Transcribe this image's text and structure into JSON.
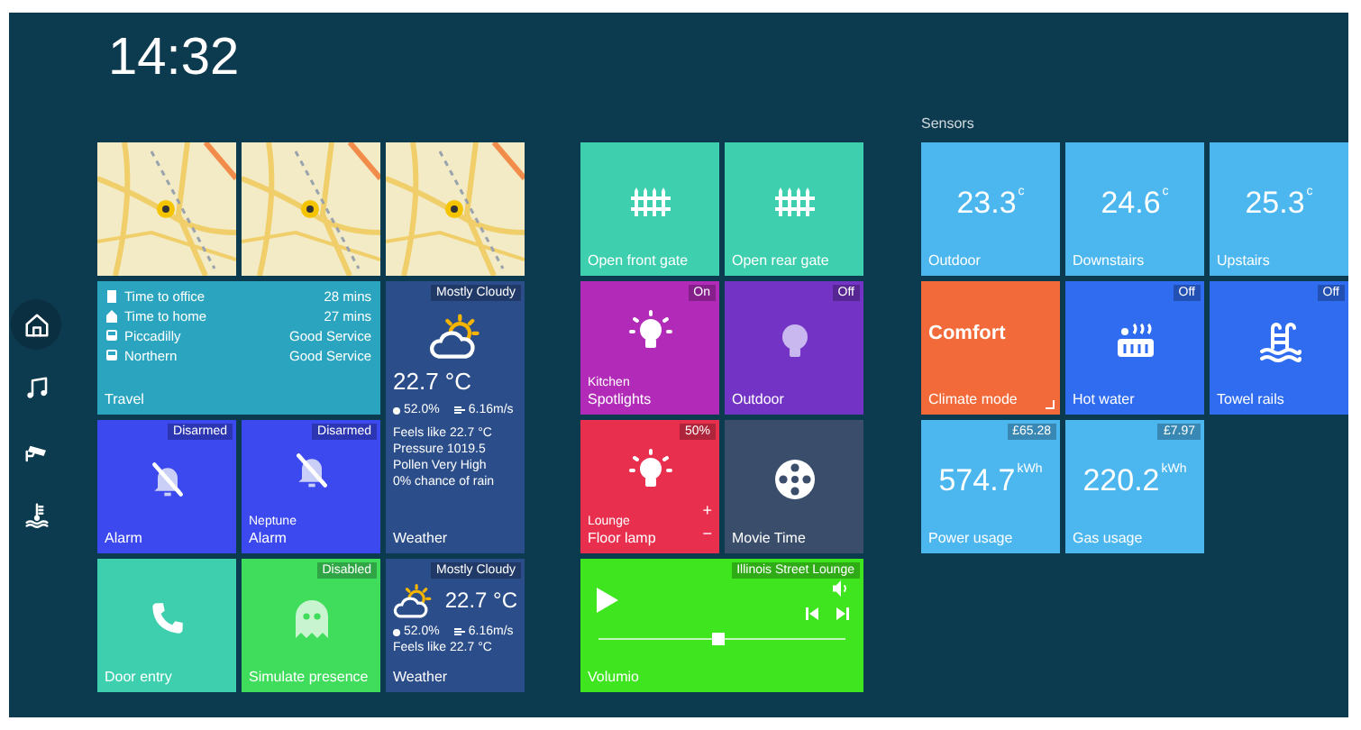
{
  "clock": "14:32",
  "sidebar": {
    "items": [
      {
        "kind": "home",
        "selected": true
      },
      {
        "kind": "music",
        "selected": false
      },
      {
        "kind": "camera",
        "selected": false
      },
      {
        "kind": "water-temp",
        "selected": false
      }
    ]
  },
  "groups": [
    {
      "tiles": [
        {
          "kind": "map",
          "color": "#f3ebc6"
        },
        {
          "kind": "map",
          "color": "#f3ebc6"
        },
        {
          "kind": "map",
          "color": "#f3ebc6"
        },
        {
          "kind": "travel",
          "color": "#2ba5bf",
          "label": "Travel",
          "rows": [
            {
              "name": "Time to office",
              "value": "28 mins"
            },
            {
              "name": "Time to home",
              "value": "27 mins"
            },
            {
              "name": "Piccadilly",
              "value": "Good Service"
            },
            {
              "name": "Northern",
              "value": "Good Service"
            }
          ]
        },
        {
          "kind": "alarm",
          "color": "#3c49ee",
          "badge": "Disarmed",
          "label": "Alarm"
        },
        {
          "kind": "alarm",
          "color": "#3c49ee",
          "badge": "Disarmed",
          "sublabel": "Neptune",
          "label": "Alarm"
        },
        {
          "kind": "weather",
          "color": "#2b4d8a",
          "badge": "Mostly Cloudy",
          "temp": "22.7 °C",
          "humidity": "52.0%",
          "wind": "6.16m/s",
          "details": [
            "Feels like 22.7 °C",
            "Pressure 1019.5",
            "Pollen Very High",
            "0% chance of rain"
          ],
          "label": "Weather"
        },
        {
          "kind": "phone",
          "color": "#3ecfae",
          "label": "Door entry"
        },
        {
          "kind": "ghost",
          "color": "#40dc5c",
          "badge": "Disabled",
          "label": "Simulate presence"
        },
        {
          "kind": "weather-small",
          "color": "#2b4d8a",
          "badge": "Mostly Cloudy",
          "temp": "22.7 °C",
          "humidity": "52.0%",
          "wind": "6.16m/s",
          "details": [
            "Feels like 22.7 °C"
          ],
          "label": "Weather"
        }
      ]
    },
    {
      "tiles": [
        {
          "kind": "gate",
          "color": "#3ecfae",
          "label": "Open front gate"
        },
        {
          "kind": "gate",
          "color": "#3ecfae",
          "label": "Open rear gate"
        },
        {
          "kind": "light",
          "color": "#b22bb8",
          "badge": "On",
          "on": true,
          "sublabel": "Kitchen",
          "label": "Spotlights"
        },
        {
          "kind": "light",
          "color": "#7333c4",
          "badge": "Off",
          "on": false,
          "label": "Outdoor"
        },
        {
          "kind": "light",
          "color": "#e8304e",
          "badge": "50%",
          "on": true,
          "sublabel": "Lounge",
          "label": "Floor lamp",
          "plus": "+",
          "minus": "−"
        },
        {
          "kind": "film",
          "color": "#3a4e6c",
          "label": "Movie Time"
        },
        {
          "kind": "player",
          "color": "#3fe51e",
          "badge": "Illinois Street Lounge",
          "level": 0.48,
          "label": "Volumio"
        }
      ]
    },
    {
      "title": "Sensors",
      "tiles": [
        {
          "kind": "reading",
          "color": "#4cb6ef",
          "value": "23.3",
          "unit": "c",
          "label": "Outdoor"
        },
        {
          "kind": "reading",
          "color": "#4cb6ef",
          "value": "24.6",
          "unit": "c",
          "label": "Downstairs"
        },
        {
          "kind": "reading",
          "color": "#4cb6ef",
          "value": "25.3",
          "unit": "c",
          "label": "Upstairs"
        },
        {
          "kind": "mode",
          "color": "#f26a3a",
          "value": "Comfort",
          "label": "Climate mode"
        },
        {
          "kind": "hot-tub",
          "color": "#2f6cef",
          "badge": "Off",
          "label": "Hot water"
        },
        {
          "kind": "pool",
          "color": "#2f6cef",
          "badge": "Off",
          "label": "Towel rails"
        },
        {
          "kind": "reading",
          "color": "#4cb6ef",
          "badge": "£65.28",
          "value": "574.7",
          "unit": "kWh",
          "label": "Power usage"
        },
        {
          "kind": "reading",
          "color": "#4cb6ef",
          "badge": "£7.97",
          "value": "220.2",
          "unit": "kWh",
          "label": "Gas usage"
        }
      ]
    }
  ]
}
